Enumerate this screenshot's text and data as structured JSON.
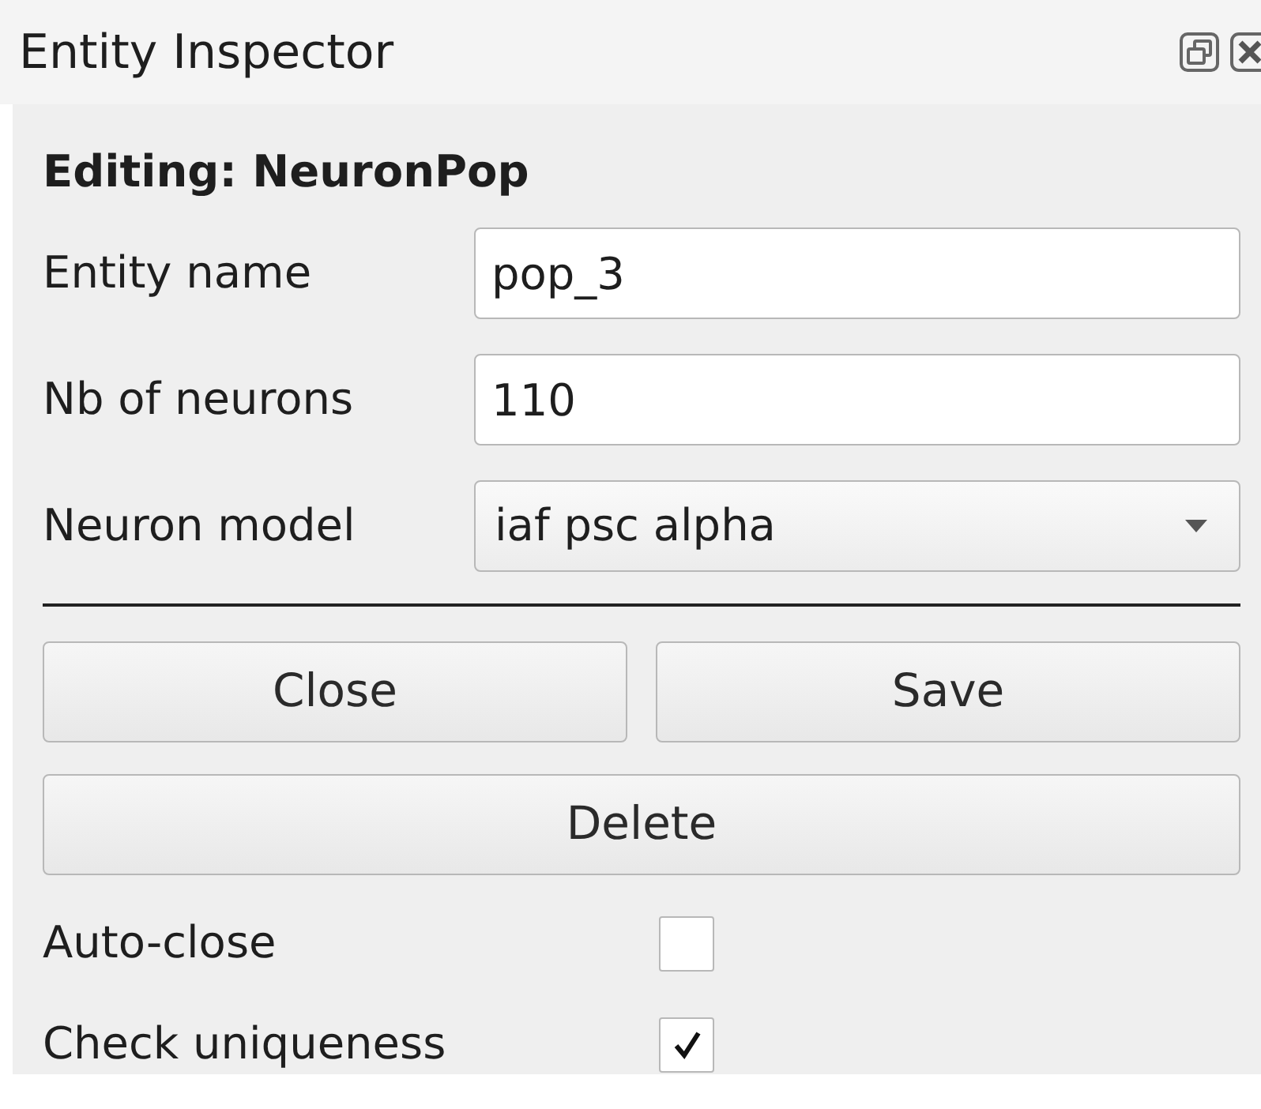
{
  "window": {
    "title": "Entity Inspector"
  },
  "heading": "Editing: NeuronPop",
  "fields": [
    {
      "kind": "text",
      "label": "Entity name",
      "value": "pop_3"
    },
    {
      "kind": "text",
      "label": "Nb of neurons",
      "value": "110"
    },
    {
      "kind": "select",
      "label": "Neuron model",
      "value": "iaf psc alpha"
    }
  ],
  "buttons": [
    {
      "label": "Close"
    },
    {
      "label": "Save"
    },
    {
      "label": "Delete"
    }
  ],
  "checkboxes": [
    {
      "label": "Auto-close",
      "checked": false
    },
    {
      "label": "Check uniqueness",
      "checked": true
    }
  ]
}
